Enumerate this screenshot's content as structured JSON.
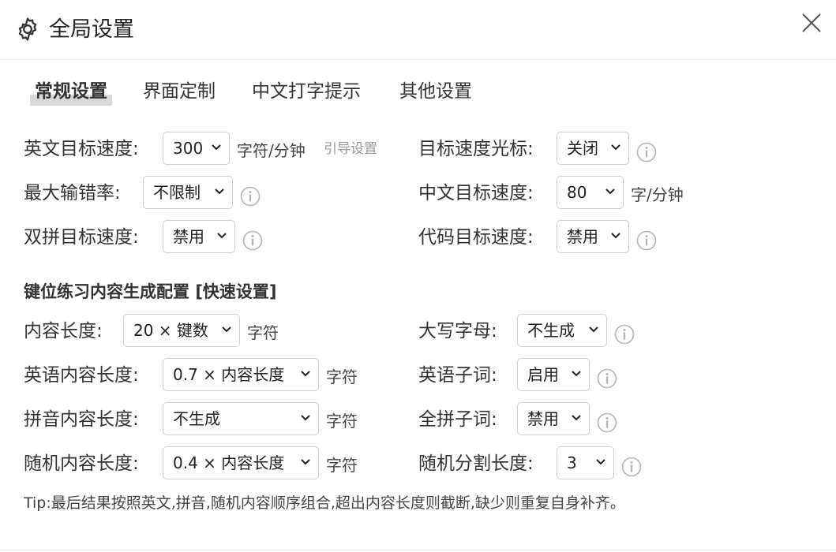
{
  "dialog": {
    "title": "全局设置",
    "icon": "gear-icon",
    "close_icon": "close-icon"
  },
  "tabs": [
    {
      "label": "常规设置",
      "active": true
    },
    {
      "label": "界面定制",
      "active": false
    },
    {
      "label": "中文打字提示",
      "active": false
    },
    {
      "label": "其他设置",
      "active": false
    }
  ],
  "general": {
    "en_target_speed": {
      "label": "英文目标速度:",
      "value": "300",
      "unit": "字符/分钟",
      "guide": "引导设置"
    },
    "max_error_rate": {
      "label": "最大输错率:",
      "value": "不限制"
    },
    "shuangpin_target_speed": {
      "label": "双拼目标速度:",
      "value": "禁用"
    },
    "target_speed_cursor": {
      "label": "目标速度光标:",
      "value": "关闭"
    },
    "cn_target_speed": {
      "label": "中文目标速度:",
      "value": "80",
      "unit": "字/分钟"
    },
    "code_target_speed": {
      "label": "代码目标速度:",
      "value": "禁用"
    }
  },
  "content_config": {
    "heading": "键位练习内容生成配置",
    "quick_link": "[快速设置]",
    "content_length": {
      "label": "内容长度:",
      "value": "20 × 键数",
      "unit": "字符"
    },
    "en_content_length": {
      "label": "英语内容长度:",
      "value": "0.7 × 内容长度",
      "unit": "字符"
    },
    "pinyin_content_length": {
      "label": "拼音内容长度:",
      "value": "不生成",
      "unit": "字符"
    },
    "random_content_length": {
      "label": "随机内容长度:",
      "value": "0.4 × 内容长度",
      "unit": "字符"
    },
    "uppercase": {
      "label": "大写字母:",
      "value": "不生成"
    },
    "en_subword": {
      "label": "英语子词:",
      "value": "启用"
    },
    "quanpin_subword": {
      "label": "全拼子词:",
      "value": "禁用"
    },
    "random_split_length": {
      "label": "随机分割长度:",
      "value": "3"
    }
  },
  "tip": "Tip:最后结果按照英文,拼音,随机内容顺序组合,超出内容长度则截断,缺少则重复自身补齐。",
  "colors": {
    "border": "#cfcfcf",
    "tab_highlight": "#d9d9d9",
    "muted_text": "#9a9a9a",
    "info_icon": "#b5b5b5"
  }
}
